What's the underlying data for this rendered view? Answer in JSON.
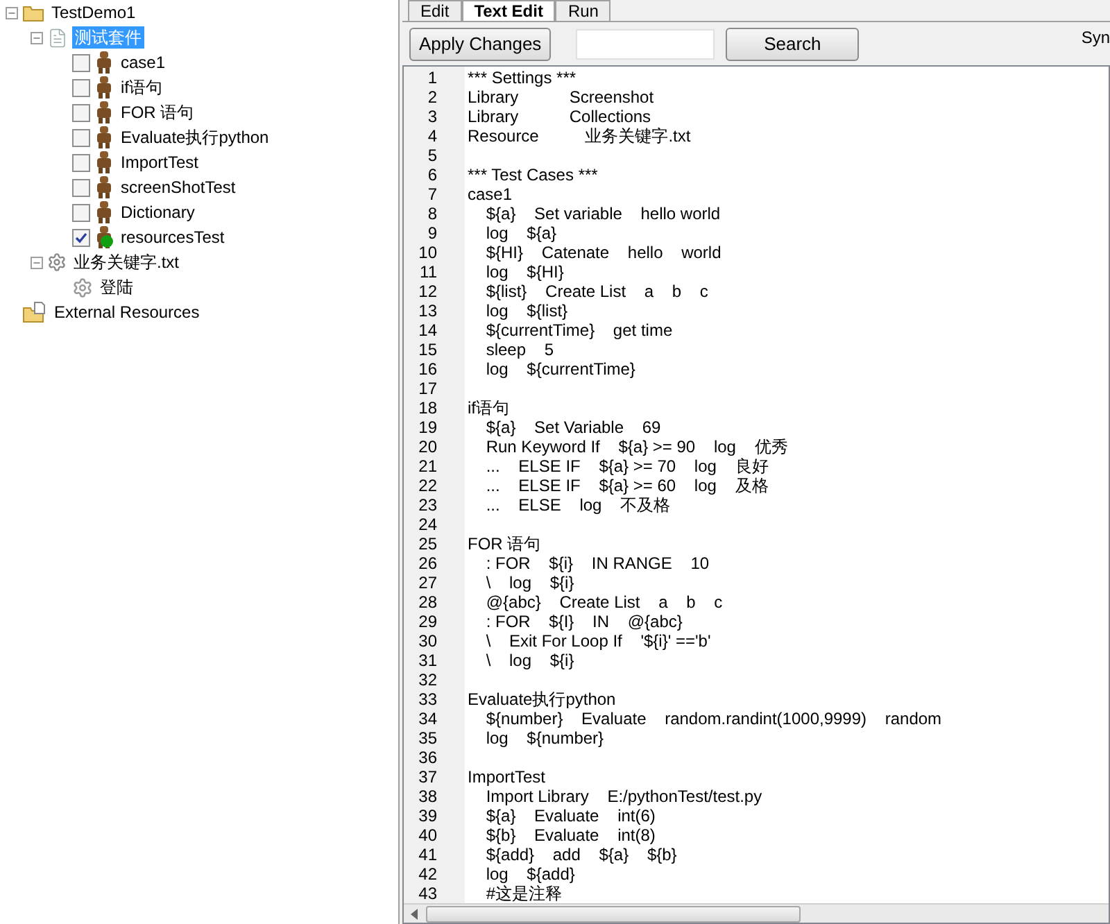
{
  "tree": [
    {
      "label": "TestDemo1",
      "kind": "project",
      "selected": false,
      "expanded": true,
      "children": [
        {
          "label": "测试套件",
          "kind": "suite",
          "selected": true,
          "expanded": true,
          "children": [
            {
              "label": "case1",
              "kind": "test",
              "selected": false,
              "checked": false,
              "passed": false
            },
            {
              "label": "if语句",
              "kind": "test",
              "selected": false,
              "checked": false,
              "passed": false
            },
            {
              "label": "FOR 语句",
              "kind": "test",
              "selected": false,
              "checked": false,
              "passed": false
            },
            {
              "label": "Evaluate执行python",
              "kind": "test",
              "selected": false,
              "checked": false,
              "passed": false
            },
            {
              "label": "ImportTest",
              "kind": "test",
              "selected": false,
              "checked": false,
              "passed": false
            },
            {
              "label": "screenShotTest",
              "kind": "test",
              "selected": false,
              "checked": false,
              "passed": false
            },
            {
              "label": "Dictionary",
              "kind": "test",
              "selected": false,
              "checked": false,
              "passed": false
            },
            {
              "label": "resourcesTest",
              "kind": "test",
              "selected": false,
              "checked": true,
              "passed": true
            }
          ]
        },
        {
          "label": "业务关键字.txt",
          "kind": "resource",
          "selected": false,
          "expanded": true,
          "children": [
            {
              "label": "登陆",
              "kind": "keyword",
              "selected": false
            }
          ]
        }
      ]
    },
    {
      "label": "External Resources",
      "kind": "external",
      "selected": false
    }
  ],
  "tabs": [
    {
      "label": "Edit",
      "selected": false
    },
    {
      "label": "Text Edit",
      "selected": true
    },
    {
      "label": "Run",
      "selected": false
    }
  ],
  "toolbar": {
    "apply_button": "Apply Changes",
    "search_button": "Search",
    "syntax_label": "Syn"
  },
  "editor": {
    "lines": [
      {
        "number": "1",
        "text": "*** Settings ***"
      },
      {
        "number": "2",
        "text": "Library           Screenshot"
      },
      {
        "number": "3",
        "text": "Library           Collections"
      },
      {
        "number": "4",
        "text": "Resource          业务关键字.txt"
      },
      {
        "number": "5"
      },
      {
        "number": "6",
        "text": "*** Test Cases ***"
      },
      {
        "number": "7",
        "text": "case1"
      },
      {
        "number": "8",
        "text": "    ${a}    Set variable    hello world"
      },
      {
        "number": "9",
        "text": "    log    ${a}"
      },
      {
        "number": "10",
        "text": "    ${HI}    Catenate    hello    world"
      },
      {
        "number": "11",
        "text": "    log    ${HI}"
      },
      {
        "number": "12",
        "text": "    ${list}    Create List    a    b    c"
      },
      {
        "number": "13",
        "text": "    log    ${list}"
      },
      {
        "number": "14",
        "text": "    ${currentTime}    get time"
      },
      {
        "number": "15",
        "text": "    sleep    5"
      },
      {
        "number": "16",
        "text": "    log    ${currentTime}"
      },
      {
        "number": "17"
      },
      {
        "number": "18",
        "text": "if语句"
      },
      {
        "number": "19",
        "text": "    ${a}    Set Variable    69"
      },
      {
        "number": "20",
        "text": "    Run Keyword If    ${a} >= 90    log    优秀"
      },
      {
        "number": "21",
        "text": "    ...    ELSE IF    ${a} >= 70    log    良好"
      },
      {
        "number": "22",
        "text": "    ...    ELSE IF    ${a} >= 60    log    及格"
      },
      {
        "number": "23",
        "text": "    ...    ELSE    log    不及格"
      },
      {
        "number": "24"
      },
      {
        "number": "25",
        "text": "FOR 语句"
      },
      {
        "number": "26",
        "text": "    : FOR    ${i}    IN RANGE    10"
      },
      {
        "number": "27",
        "text": "    \\    log    ${i}"
      },
      {
        "number": "28",
        "text": "    @{abc}    Create List    a    b    c"
      },
      {
        "number": "29",
        "text": "    : FOR    ${I}    IN    @{abc}"
      },
      {
        "number": "30",
        "text": "    \\    Exit For Loop If    '${i}' =='b'"
      },
      {
        "number": "31",
        "text": "    \\    log    ${i}"
      },
      {
        "number": "32"
      },
      {
        "number": "33",
        "text": "Evaluate执行python"
      },
      {
        "number": "34",
        "text": "    ${number}    Evaluate    random.randint(1000,9999)    random"
      },
      {
        "number": "35",
        "text": "    log    ${number}"
      },
      {
        "number": "36"
      },
      {
        "number": "37",
        "text": "ImportTest"
      },
      {
        "number": "38",
        "text": "    Import Library    E:/pythonTest/test.py"
      },
      {
        "number": "39",
        "text": "    ${a}    Evaluate    int(6)"
      },
      {
        "number": "40",
        "text": "    ${b}    Evaluate    int(8)"
      },
      {
        "number": "41",
        "text": "    ${add}    add    ${a}    ${b}"
      },
      {
        "number": "42",
        "text": "    log    ${add}"
      },
      {
        "number": "43",
        "text": "    #这是注释"
      }
    ]
  }
}
